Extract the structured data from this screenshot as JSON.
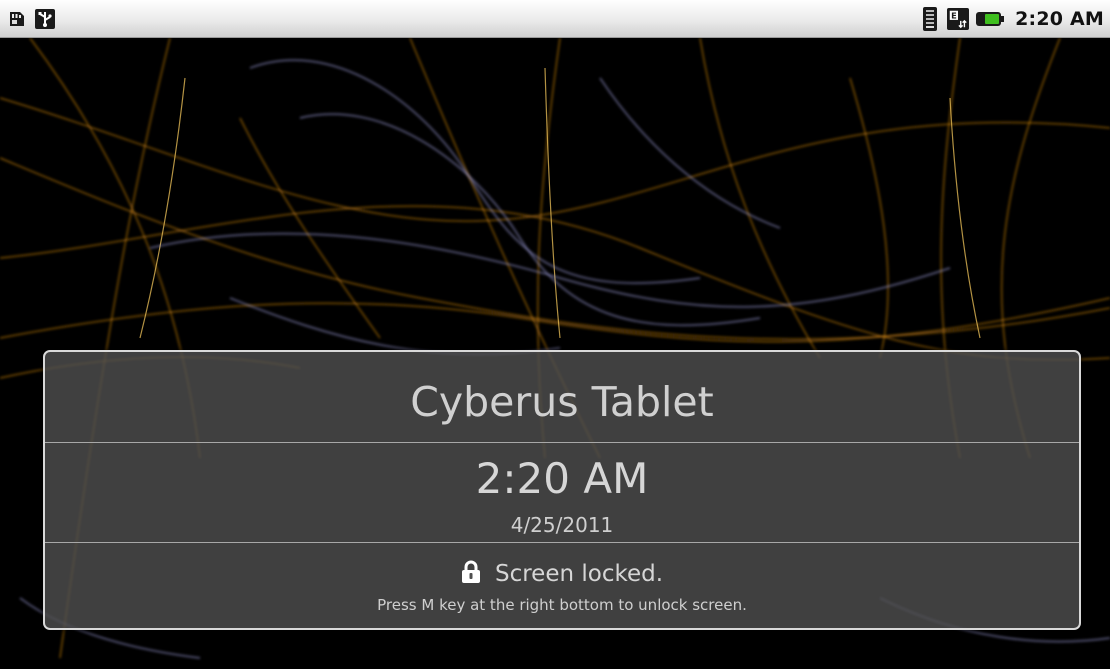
{
  "status_bar": {
    "left_icons": [
      "sd-card-icon",
      "usb-icon"
    ],
    "right_icons": [
      "wifi-signal-icon",
      "data-transfer-icon",
      "battery-icon"
    ],
    "time": "2:20 AM",
    "battery_color": "#3fbf1f"
  },
  "lock_screen": {
    "device_name": "Cyberus Tablet",
    "time": "2:20 AM",
    "date": "4/25/2011",
    "status": "Screen locked.",
    "hint": "Press M key at the right bottom to unlock screen.",
    "lock_icon": "padlock-icon"
  },
  "wallpaper": {
    "description_colors": [
      "#000000",
      "#e0901a",
      "#a8a8e8"
    ]
  }
}
